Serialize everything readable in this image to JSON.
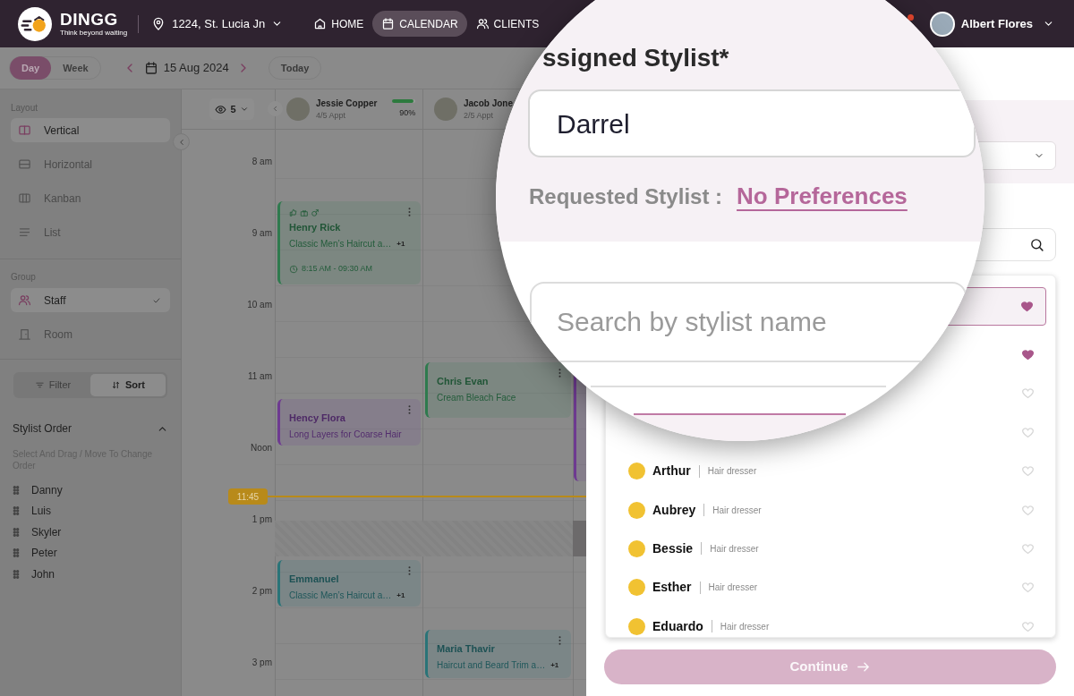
{
  "header": {
    "brand": "DINGG",
    "tagline": "Think beyond waiting",
    "location": "1224, St. Lucia Jn",
    "nav": [
      {
        "label": "HOME",
        "selected": false
      },
      {
        "label": "CALENDAR",
        "selected": true
      },
      {
        "label": "CLIENTS",
        "selected": false
      }
    ],
    "notification": true,
    "user": "Albert Flores"
  },
  "toolbar": {
    "views": [
      {
        "label": "Day",
        "selected": true
      },
      {
        "label": "Week",
        "selected": false
      }
    ],
    "date": "15 Aug 2024",
    "today": "Today"
  },
  "sidebar": {
    "layout_label": "Layout",
    "layouts": [
      {
        "label": "Vertical",
        "selected": true
      },
      {
        "label": "Horizontal",
        "selected": false
      },
      {
        "label": "Kanban",
        "selected": false
      },
      {
        "label": "List",
        "selected": false
      }
    ],
    "group_label": "Group",
    "groups": [
      {
        "label": "Staff",
        "selected": true
      },
      {
        "label": "Room",
        "selected": false
      }
    ],
    "modes": [
      {
        "label": "Filter",
        "selected": false
      },
      {
        "label": "Sort",
        "selected": true
      }
    ],
    "order_title": "Stylist Order",
    "order_expanded": true,
    "order_hint": "Select And Drag / Move To Change Order",
    "order": [
      "Danny",
      "Luis",
      "Skyler",
      "Peter",
      "John"
    ]
  },
  "calendar": {
    "visible_count": "5",
    "times": [
      "8 am",
      "9 am",
      "10 am",
      "11 am",
      "Noon",
      "1 pm",
      "2 pm",
      "3 pm"
    ],
    "now": "11:45",
    "staff": [
      {
        "name": "Jessie Copper",
        "appts": "4/5 Appt",
        "level": 0.9,
        "percent": "90%",
        "appointments": [
          {
            "client": "Henry Rick",
            "service": "Classic Men’s Haircut a…",
            "extra": "+1",
            "time": "8:15 AM - 09:30 AM",
            "tagged": true,
            "color": "#2f7a4e"
          },
          {
            "client": "Hency Flora",
            "service": "Long Layers for Coarse Hair",
            "tagged": false,
            "color": "#6e3a91"
          },
          {
            "client": "Emmanuel",
            "service": "Classic Men’s Haircut a…",
            "extra": "+1",
            "tagged": false,
            "color": "#2a7478"
          }
        ]
      },
      {
        "name": "Jacob Jone",
        "appts": "2/5 Appt",
        "appointments": [
          {
            "client": "Chris Evan",
            "service": "Cream Bleach Face",
            "tagged": false,
            "color": "#2f7a4e"
          },
          {
            "client": "Maria Thavir",
            "service": "Haircut and Beard Trim a…",
            "extra": "+1",
            "tagged": false,
            "color": "#2a7478"
          }
        ]
      },
      {
        "appointments": [
          {
            "color": "#6e3a91"
          }
        ]
      }
    ]
  },
  "drawer": {
    "title": "ssigned Stylist*",
    "assigned": "Darrel",
    "requested_label": "Requested Stylist :",
    "requested_value": "No Preferences",
    "search_placeholder": "Search by stylist name",
    "stylists": [
      {
        "selected": true,
        "favorite": true
      },
      {
        "selected": false,
        "favorite": true
      },
      {
        "selected": false,
        "favorite": false
      },
      {
        "selected": false,
        "favorite": false
      },
      {
        "name": "Arthur",
        "role": "Hair dresser",
        "selected": false,
        "favorite": false
      },
      {
        "name": "Aubrey",
        "role": "Hair dresser",
        "selected": false,
        "favorite": false
      },
      {
        "name": "Bessie",
        "role": "Hair dresser",
        "selected": false,
        "favorite": false
      },
      {
        "name": "Esther",
        "role": "Hair dresser",
        "selected": false,
        "favorite": false
      },
      {
        "name": "Eduardo",
        "role": "Hair dresser",
        "selected": false,
        "favorite": false
      }
    ],
    "continue": "Continue",
    "continue_disabled": true
  }
}
